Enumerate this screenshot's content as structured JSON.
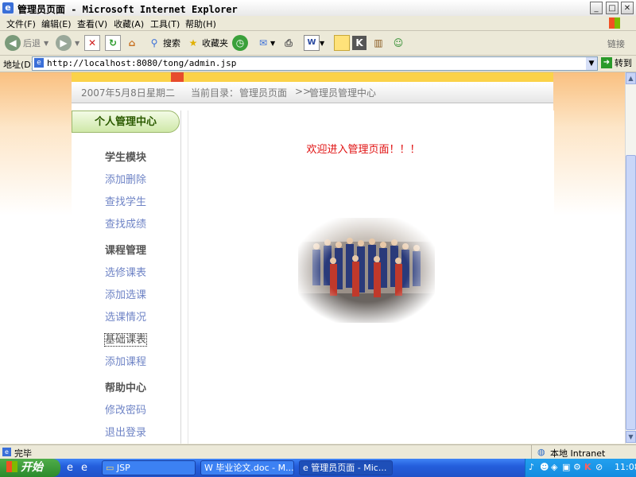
{
  "window": {
    "title": "管理员页面 - Microsoft Internet Explorer",
    "minimize": "_",
    "maximize": "□",
    "close": "✕"
  },
  "menubar": {
    "items": [
      "文件(F)",
      "编辑(E)",
      "查看(V)",
      "收藏(A)",
      "工具(T)",
      "帮助(H)"
    ]
  },
  "toolbar": {
    "back": "后退",
    "search": "搜索",
    "favorites": "收藏夹",
    "links": "链接"
  },
  "addressbar": {
    "label": "地址(D)",
    "url": "http://localhost:8080/tong/admin.jsp",
    "go": "转到"
  },
  "page": {
    "date": "2007年5月8日",
    "weekday": "星期二",
    "breadcrumb_prefix": "当前目录：",
    "breadcrumb_1": "管理员页面",
    "breadcrumb_sep": ">>",
    "breadcrumb_2": "管理员管理中心",
    "sidebar_title": "个人管理中心",
    "section_student": "学生模块",
    "link_add_delete": "添加删除",
    "link_find_student": "查找学生",
    "link_find_score": "查找成绩",
    "section_course": "课程管理",
    "link_elective_table": "选修课表",
    "link_add_elective": "添加选课",
    "link_elective_status": "选课情况",
    "link_basic_table": "基础课表",
    "link_add_course": "添加课程",
    "section_help": "帮助中心",
    "link_change_password": "修改密码",
    "link_logout": "退出登录",
    "welcome": "欢迎进入管理页面！！！"
  },
  "status": {
    "left": "完毕",
    "zone": "本地 Intranet"
  },
  "taskbar": {
    "start": "开始",
    "tasks": [
      "JSP",
      "毕业论文.doc - M...",
      "管理员页面 - Mic..."
    ],
    "clock": "11:08"
  },
  "colors": {
    "accent_red": "#e01010",
    "link_blue": "#6f84c6",
    "taskbar_blue": "#245edc"
  }
}
